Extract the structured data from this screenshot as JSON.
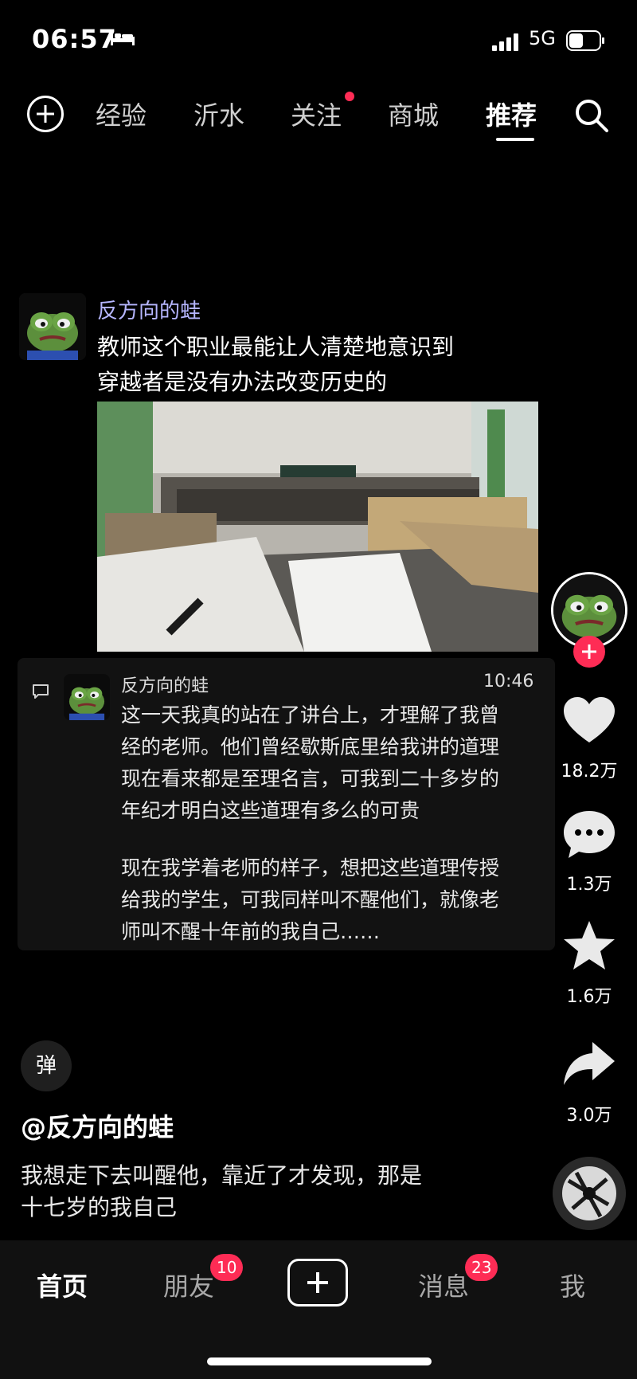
{
  "status_bar": {
    "time": "06:57",
    "network": "5G"
  },
  "top_nav": {
    "tabs": [
      {
        "label": "经验"
      },
      {
        "label": "沂水"
      },
      {
        "label": "关注"
      },
      {
        "label": "商城"
      },
      {
        "label": "推荐"
      }
    ]
  },
  "post": {
    "username": "反方向的蛙",
    "text_lines": [
      "教师这个职业最能让人清楚地意识到",
      "穿越者是没有办法改变历史的"
    ]
  },
  "comment": {
    "username": "反方向的蛙",
    "time": "10:46",
    "lines": [
      "这一天我真的站在了讲台上，才理解了我曾",
      "经的老师。他们曾经歇斯底里给我讲的道理",
      "现在看来都是至理名言，可我到二十多岁的",
      "年纪才明白这些道理有多么的可贵",
      "",
      "现在我学着老师的样子，想把这些道理传授",
      "给我的学生，可我同样叫不醒他们，就像老",
      "师叫不醒十年前的我自己……"
    ]
  },
  "right_rail": {
    "likes": "18.2万",
    "comments": "1.3万",
    "favorites": "1.6万",
    "shares": "3.0万"
  },
  "video": {
    "danmu_label": "弹",
    "author": "@反方向的蛙",
    "caption_lines": [
      "我想走下去叫醒他，靠近了才发现，那是",
      "十七岁的我自己"
    ]
  },
  "bottom_bar": {
    "home": "首页",
    "friends": "朋友",
    "friends_badge": "10",
    "messages": "消息",
    "messages_badge": "23",
    "me": "我"
  },
  "colors": {
    "accent": "#fe2c55",
    "background": "#000000",
    "username": "#b6b6ff"
  }
}
